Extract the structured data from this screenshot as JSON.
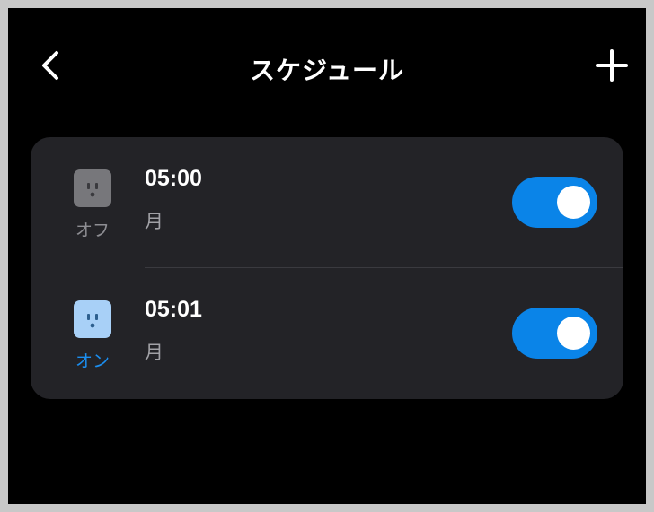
{
  "header": {
    "title": "スケジュール",
    "back_icon": "chevron-left-icon",
    "add_icon": "plus-icon"
  },
  "colors": {
    "background": "#000000",
    "card": "#232327",
    "accent": "#0a84e8",
    "on_label": "#1b8ef0",
    "off_label": "#8e8e93"
  },
  "schedules": [
    {
      "state_label": "オフ",
      "state": "off",
      "icon": "outlet-icon",
      "time": "05:00",
      "days": "月",
      "enabled": true
    },
    {
      "state_label": "オン",
      "state": "on",
      "icon": "outlet-icon",
      "time": "05:01",
      "days": "月",
      "enabled": true
    }
  ]
}
